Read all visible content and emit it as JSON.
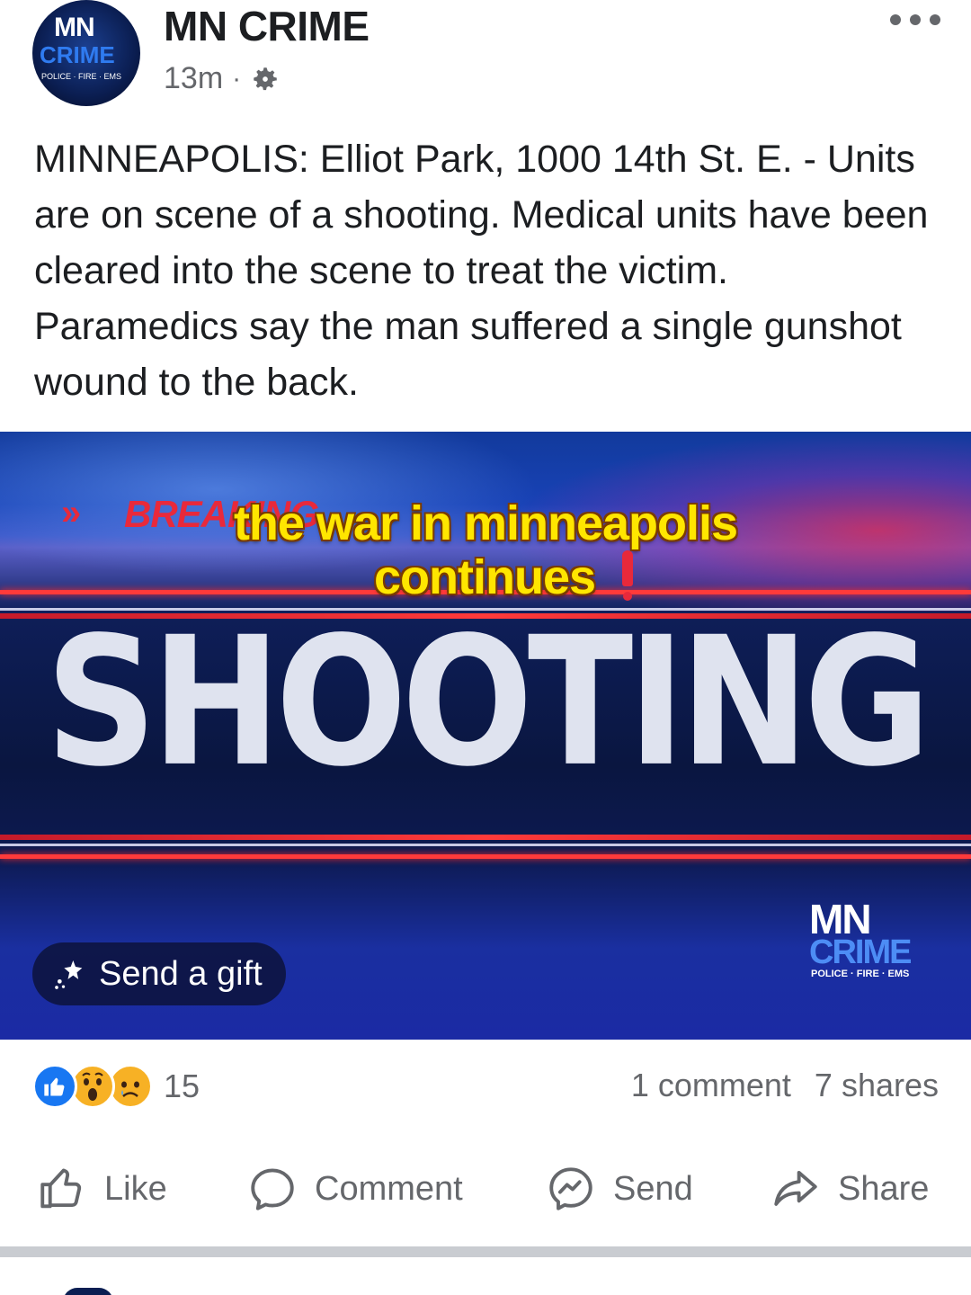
{
  "post": {
    "page_name": "MN CRIME",
    "time": "13m",
    "separator": "·",
    "text": "MINNEAPOLIS: Elliot Park, 1000 14th St. E. - Units are on scene of a shooting. Medical units have been cleared into the scene to treat the victim. Paramedics say the man suffered a single gunshot wound to the back."
  },
  "avatar": {
    "line1": "MN",
    "line2": "CRIME",
    "line3": "POLICE · FIRE · EMS"
  },
  "media": {
    "breaking_label": "BREAKING",
    "headline": "SHOOTING",
    "caption_line1": "the war in minneapolis",
    "caption_line2": "continues",
    "logo_line1": "MN",
    "logo_line2": "CRIME",
    "logo_line3": "POLICE · FIRE · EMS",
    "gift_label": "Send a gift"
  },
  "engagement": {
    "reaction_count": "15",
    "comments": "1 comment",
    "shares": "7 shares"
  },
  "actions": {
    "like": "Like",
    "comment": "Comment",
    "send": "Send",
    "share": "Share"
  },
  "colors": {
    "brand_blue": "#1877f2",
    "text_primary": "#1c1e21",
    "text_secondary": "#65676b",
    "caption_yellow": "#ffe600",
    "breaking_red": "#e8293b"
  }
}
